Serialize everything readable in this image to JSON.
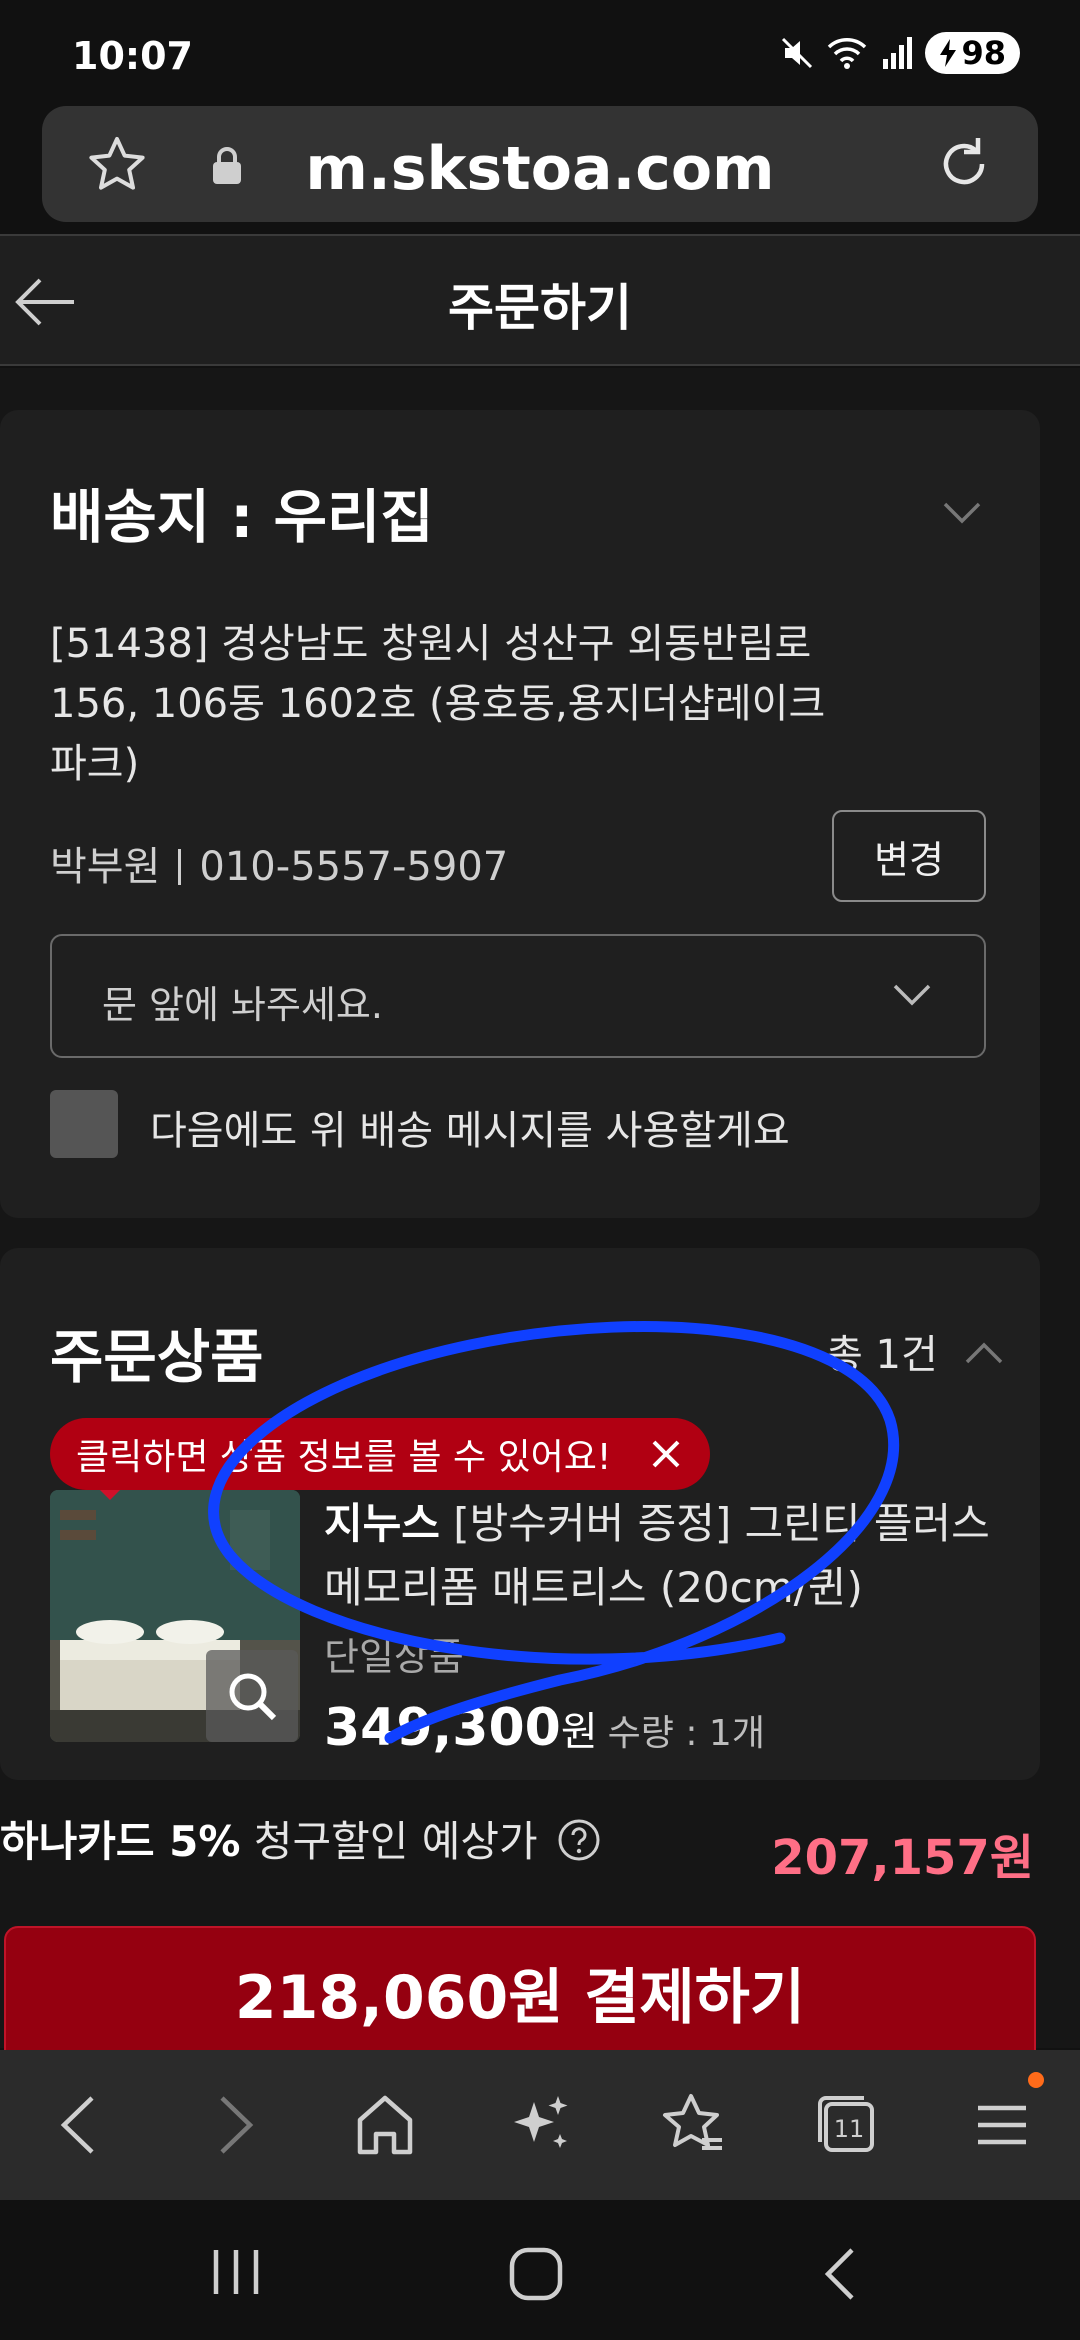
{
  "status": {
    "time": "10:07",
    "battery": "98",
    "icons": [
      "mute-icon",
      "wifi-icon",
      "signal-icon",
      "battery-charging-icon"
    ]
  },
  "browser": {
    "url": "m.skstoa.com"
  },
  "header": {
    "title": "주문하기"
  },
  "delivery": {
    "title": "배송지 : 우리집",
    "address": "[51438] 경상남도 창원시 성산구 외동반림로 156, 106동 1602호 (용호동,용지더샵레이크파크)",
    "name": "박부원",
    "phone": "010-5557-5907",
    "change_label": "변경",
    "message_placeholder": "문 앞에 놔주세요.",
    "remember_label": "다음에도 위 배송 메시지를 사용할게요"
  },
  "order": {
    "title": "주문상품",
    "count": "총 1건",
    "tooltip": "클릭하면 상품 정보를 볼 수 있어요!",
    "product": {
      "brand": "지누스",
      "name": "[방수커버 증정] 그린티 플러스 메모리폼 매트리스 (20cm/퀸)",
      "type": "단일상품",
      "price": "349,300",
      "price_unit": "원",
      "qty": "수량 : 1개"
    }
  },
  "card_discount": {
    "card": "하나카드 5%",
    "label": "청구할인 예상가",
    "price": "207,157원"
  },
  "pay_button": "218,060원 결제하기",
  "colors": {
    "accent": "#950010",
    "discount": "#ff6f86",
    "annotation": "#1040ff"
  }
}
